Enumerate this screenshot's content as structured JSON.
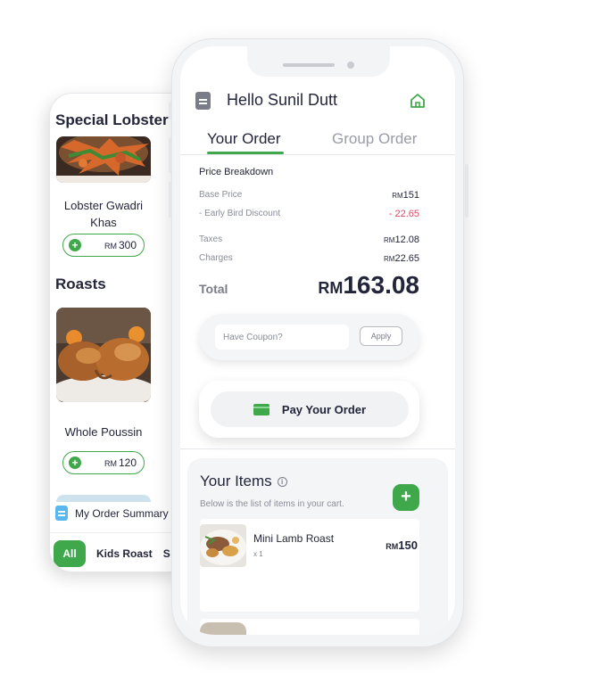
{
  "back_screen": {
    "sections": [
      {
        "heading": "Special Lobster",
        "item": {
          "name": "Lobster Gwadri Khas",
          "currency": "RM",
          "price": "300"
        }
      },
      {
        "heading": "Roasts",
        "item": {
          "name": "Whole Poussin",
          "currency": "RM",
          "price": "120"
        }
      }
    ],
    "summary_label": "My Order Summary",
    "category_tabs": [
      "All",
      "Kids Roast",
      "S"
    ]
  },
  "header": {
    "greeting": "Hello Sunil Dutt",
    "icons": {
      "left": "document-icon",
      "right": "home-icon"
    }
  },
  "tabs": {
    "active": "Your Order",
    "inactive": "Group Order"
  },
  "price_breakdown": {
    "title": "Price Breakdown",
    "lines": [
      {
        "label": "Base Price",
        "currency": "RM",
        "value": "151"
      },
      {
        "label": "- Early Bird Discount",
        "currency": "",
        "value": "- 22.65"
      },
      {
        "label": "Taxes",
        "currency": "RM",
        "value": "12.08"
      },
      {
        "label": "Charges",
        "currency": "RM",
        "value": "22.65"
      }
    ],
    "total_label": "Total",
    "total_currency": "RM",
    "total_value": "163.08"
  },
  "coupon": {
    "placeholder": "Have Coupon?",
    "apply_label": "Apply"
  },
  "pay": {
    "label": "Pay Your Order"
  },
  "items": {
    "title": "Your Items",
    "subtitle": "Below is the list of items in your cart.",
    "list": [
      {
        "name": "Mini Lamb Roast",
        "qty": "x 1",
        "currency": "RM",
        "price": "150"
      }
    ]
  },
  "colors": {
    "accent": "#3fa84a",
    "discount": "#e2496a",
    "text": "#23263a",
    "muted": "#8a8d98"
  }
}
